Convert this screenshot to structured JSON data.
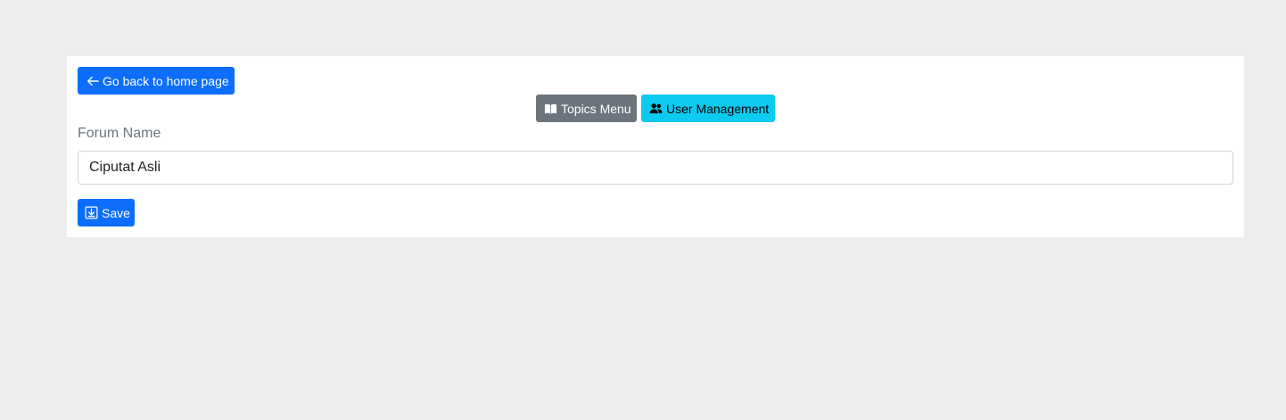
{
  "nav": {
    "back_label": "Go back to home page",
    "back_icon": "arrow-left-icon"
  },
  "menu": {
    "topics_label": "Topics Menu",
    "topics_icon": "book-icon",
    "users_label": "User Management",
    "users_icon": "people-icon"
  },
  "form": {
    "forum_name_label": "Forum Name",
    "forum_name_value": "Ciputat Asli",
    "save_label": "Save",
    "save_icon": "save-download-icon"
  },
  "colors": {
    "page_background": "#ededed",
    "panel_background": "#ffffff",
    "primary": "#0d6efd",
    "secondary": "#6c757d",
    "info": "#0dcaf0"
  }
}
